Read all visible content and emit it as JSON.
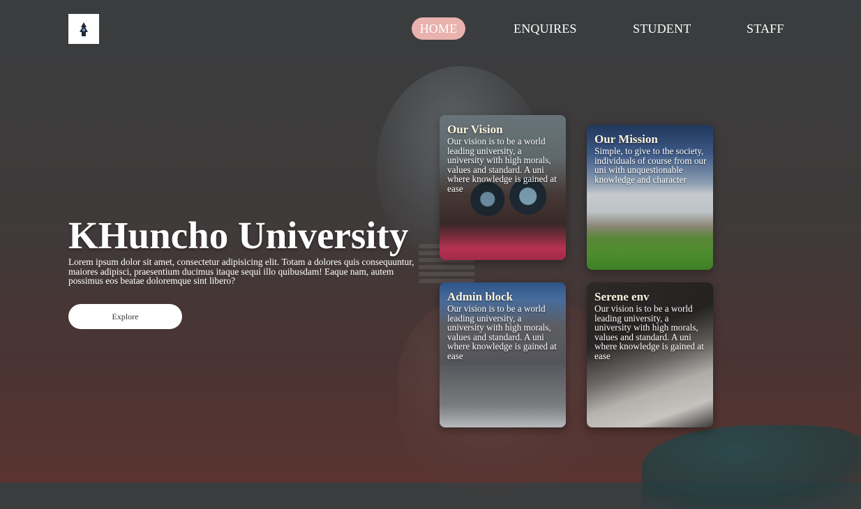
{
  "header": {
    "logo_icon": "university-logo-icon",
    "nav": [
      {
        "label": "HOME",
        "active": true
      },
      {
        "label": "ENQUIRES",
        "active": false
      },
      {
        "label": "STUDENT",
        "active": false
      },
      {
        "label": "STAFF",
        "active": false
      }
    ]
  },
  "hero": {
    "title": "KHuncho University",
    "text": "Lorem ipsum dolor sit amet, consectetur adipisicing elit. Totam a dolores quis consequuntur, maiores adipisci, praesentium ducimus itaque sequi illo quibusdam! Eaque nam, autem possimus eos beatae doloremque sint libero?",
    "button_label": "Explore"
  },
  "cards": [
    {
      "title": "Our Vision",
      "text": "Our vision is to be a world leading university, a university with high morals, values and standard. A uni where knowledge is gained at ease"
    },
    {
      "title": "Our Mission",
      "text": "Simple, to give to the society, individuals of course from our uni with unquestionable knowledge and character"
    },
    {
      "title": "Admin block",
      "text": "Our vision is to be a world leading university, a university with high morals, values and standard. A uni where knowledge is gained at ease"
    },
    {
      "title": "Serene env",
      "text": "Our vision is to be a world leading university, a university with high morals, values and standard. A uni where knowledge is gained at ease"
    }
  ],
  "colors": {
    "accent": "#e9b2ae",
    "card_title": "#fbf3de"
  }
}
